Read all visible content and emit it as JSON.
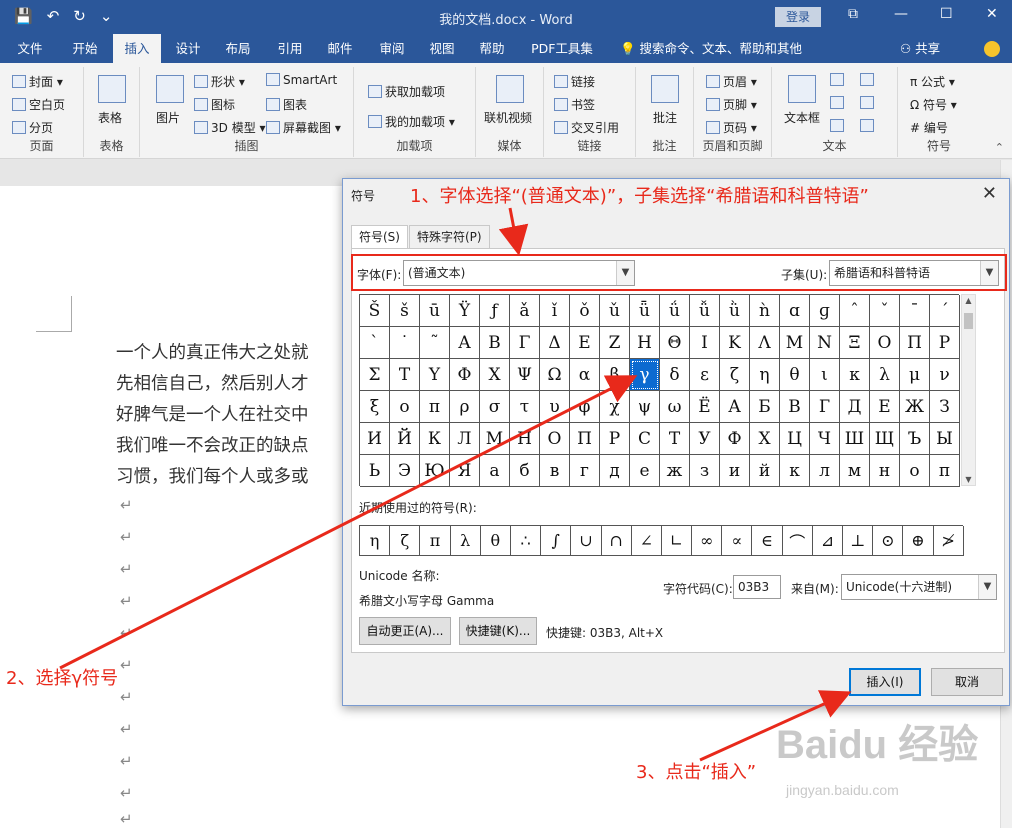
{
  "titlebar": {
    "title": "我的文档.docx  -  Word",
    "login": "登录",
    "qat": [
      "💾",
      "↶",
      "↻",
      "⌄"
    ],
    "window_controls": [
      "⧉",
      "—",
      "☐",
      "✕"
    ]
  },
  "tabs": [
    "文件",
    "开始",
    "插入",
    "设计",
    "布局",
    "引用",
    "邮件",
    "审阅",
    "视图",
    "帮助",
    "PDF工具集"
  ],
  "active_tab": "插入",
  "tellme": "💡  搜索命令、文本、帮助和其他",
  "share": "⚇ 共享",
  "ribbon": {
    "groups": {
      "pages": {
        "label": "页面",
        "items": [
          "封面 ▾",
          "空白页",
          "分页"
        ]
      },
      "table": {
        "label": "表格",
        "items": [
          "表格"
        ]
      },
      "illustrations": {
        "label": "插图",
        "items": [
          "图片",
          "形状 ▾",
          "图标",
          "3D 模型 ▾",
          "SmartArt",
          "图表",
          "屏幕截图 ▾"
        ]
      },
      "addins": {
        "label": "加载项",
        "items": [
          "获取加载项",
          "我的加载项  ▾"
        ]
      },
      "media": {
        "label": "媒体",
        "items": [
          "联机视频"
        ]
      },
      "links": {
        "label": "链接",
        "items": [
          "链接",
          "书签",
          "交叉引用"
        ]
      },
      "comments": {
        "label": "批注",
        "items": [
          "批注"
        ]
      },
      "header_footer": {
        "label": "页眉和页脚",
        "items": [
          "页眉 ▾",
          "页脚 ▾",
          "页码 ▾"
        ]
      },
      "text": {
        "label": "文本",
        "items": [
          "文本框"
        ]
      },
      "symbols": {
        "label": "符号",
        "items": [
          "π 公式 ▾",
          "Ω 符号 ▾",
          "# 编号"
        ]
      }
    }
  },
  "document": {
    "lines": [
      "一个人的真正伟大之处就",
      "先相信自己，然后别人才",
      "好脾气是一个人在社交中",
      "我们唯一不会改正的缺点",
      "习惯，我们每个人或多或"
    ],
    "return_mark": "↵"
  },
  "dialog": {
    "title": "符号",
    "close": "✕",
    "tabs": [
      "符号(S)",
      "特殊字符(P)"
    ],
    "font_label": "字体(F):",
    "font_value": "(普通文本)",
    "subset_label": "子集(U):",
    "subset_value": "希腊语和科普特语",
    "symbols": [
      [
        "Š",
        "š",
        "ū",
        "Ÿ",
        "ƒ",
        "ǎ",
        "ǐ",
        "ǒ",
        "ǔ",
        "ǖ",
        "ǘ",
        "ǚ",
        "ǜ",
        "ǹ",
        "ɑ",
        "ɡ",
        "ˆ",
        "ˇ",
        "ˉ",
        "ˊ"
      ],
      [
        "ˋ",
        "˙",
        "˜",
        "Α",
        "Β",
        "Γ",
        "Δ",
        "Ε",
        "Ζ",
        "Η",
        "Θ",
        "Ι",
        "Κ",
        "Λ",
        "Μ",
        "Ν",
        "Ξ",
        "Ο",
        "Π",
        "Ρ"
      ],
      [
        "Σ",
        "Τ",
        "Υ",
        "Φ",
        "Χ",
        "Ψ",
        "Ω",
        "α",
        "β",
        "γ",
        "δ",
        "ε",
        "ζ",
        "η",
        "θ",
        "ι",
        "κ",
        "λ",
        "μ",
        "ν"
      ],
      [
        "ξ",
        "ο",
        "π",
        "ρ",
        "σ",
        "τ",
        "υ",
        "φ",
        "χ",
        "ψ",
        "ω",
        "Ё",
        "А",
        "Б",
        "В",
        "Г",
        "Д",
        "Е",
        "Ж",
        "З"
      ],
      [
        "И",
        "Й",
        "К",
        "Л",
        "М",
        "Н",
        "О",
        "П",
        "Р",
        "С",
        "Т",
        "У",
        "Ф",
        "Х",
        "Ц",
        "Ч",
        "Ш",
        "Щ",
        "Ъ",
        "Ы"
      ],
      [
        "Ь",
        "Э",
        "Ю",
        "Я",
        "а",
        "б",
        "в",
        "г",
        "д",
        "е",
        "ж",
        "з",
        "и",
        "й",
        "к",
        "л",
        "м",
        "н",
        "о",
        "п"
      ]
    ],
    "selected_symbol": "γ",
    "recent_label": "近期使用过的符号(R):",
    "recent": [
      "η",
      "ζ",
      "π",
      "λ",
      "θ",
      "∴",
      "∫",
      "∪",
      "∩",
      "∠",
      "∟",
      "∞",
      "∝",
      "∈",
      "⌒",
      "⊿",
      "⊥",
      "⊙",
      "⊕",
      "≯"
    ],
    "unicode_name_label": "Unicode 名称:",
    "unicode_name": "希腊文小写字母 Gamma",
    "char_code_label": "字符代码(C):",
    "char_code": "03B3",
    "from_label": "来自(M):",
    "from_value": "Unicode(十六进制)",
    "autocorrect_button": "自动更正(A)...",
    "shortcut_button": "快捷键(K)...",
    "shortcut_text": "快捷键: 03B3, Alt+X",
    "insert_button": "插入(I)",
    "cancel_button": "取消"
  },
  "annotations": {
    "step1": "1、字体选择“(普通文本)”，子集选择“希腊语和科普特语”",
    "step2": "2、选择γ符号",
    "step3": "3、点击“插入”",
    "color": "#e8291b"
  },
  "watermark": {
    "text": "Baidu 经验",
    "url_text": "jingyan.baidu.com"
  }
}
